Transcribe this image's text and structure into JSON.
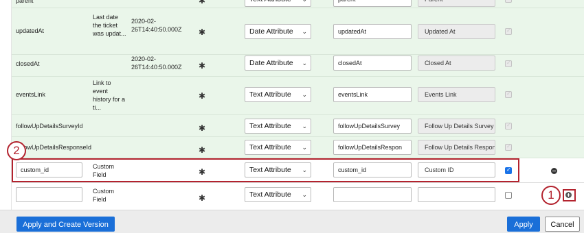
{
  "rows": [
    {
      "name": "parent",
      "description": "",
      "sample": "",
      "type": "Text Attribute",
      "field": "parent",
      "label": "Parent",
      "checked": "disabled"
    },
    {
      "name": "updatedAt",
      "description": "Last date the ticket was updat...",
      "sample": "2020-02-26T14:40:50.000Z",
      "type": "Date Attribute",
      "field": "updatedAt",
      "label": "Updated At",
      "checked": "disabled"
    },
    {
      "name": "closedAt",
      "description": "",
      "sample": "2020-02-26T14:40:50.000Z",
      "type": "Date Attribute",
      "field": "closedAt",
      "label": "Closed At",
      "checked": "disabled"
    },
    {
      "name": "eventsLink",
      "description": "Link to event history for a ti...",
      "sample": "",
      "type": "Text Attribute",
      "field": "eventsLink",
      "label": "Events Link",
      "checked": "disabled"
    },
    {
      "name": "followUpDetailsSurveyId",
      "description": "",
      "sample": "",
      "type": "Text Attribute",
      "field": "followUpDetailsSurvey",
      "label": "Follow Up Details Survey",
      "checked": "disabled"
    },
    {
      "name": "followUpDetailsResponseId",
      "description": "",
      "sample": "",
      "type": "Text Attribute",
      "field": "followUpDetailsRespon",
      "label": "Follow Up Details Respon",
      "checked": "disabled"
    },
    {
      "name": "custom_id",
      "description": "Custom Field",
      "sample": "",
      "type": "Text Attribute",
      "field": "custom_id",
      "label": "Custom ID",
      "checked": "on"
    },
    {
      "name": "",
      "description": "Custom Field",
      "sample": "",
      "type": "Text Attribute",
      "field": "",
      "label": "",
      "checked": "off"
    }
  ],
  "callouts": {
    "first": "1",
    "second": "2"
  },
  "footer": {
    "apply_create_label": "Apply and Create Version",
    "apply_label": "Apply",
    "cancel_label": "Cancel"
  },
  "icons": {
    "settings": "gear-icon",
    "dropdown": "chevron-down-icon",
    "remove": "minus-circle-icon",
    "add": "plus-circle-icon"
  },
  "colors": {
    "accent": "#1a6fd8",
    "highlight": "#b3232e",
    "row_green": "#eaf6ea"
  }
}
